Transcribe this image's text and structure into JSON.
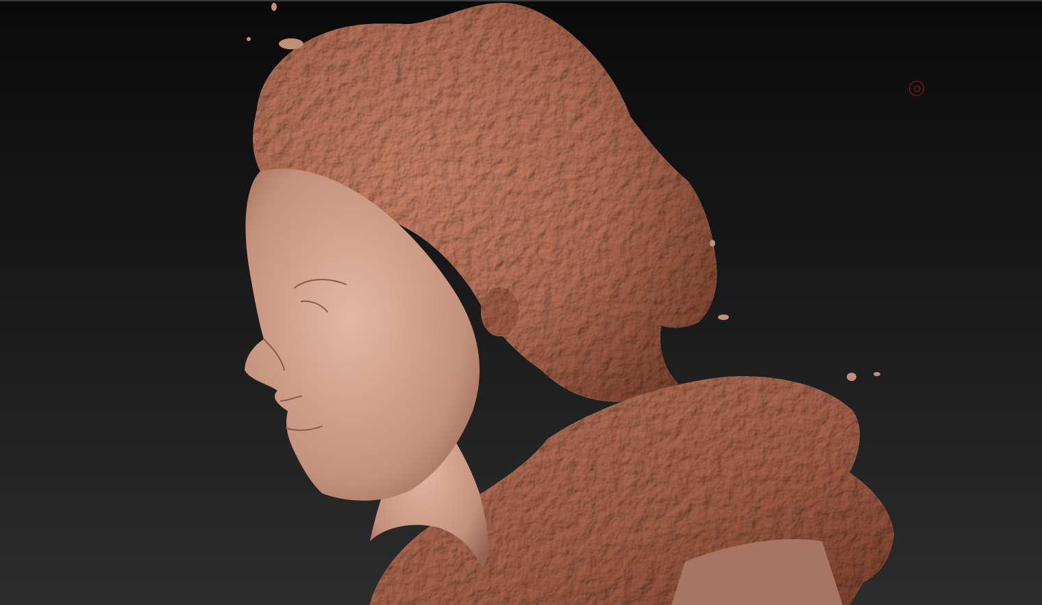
{
  "viewport": {
    "background_top": "#0a0a0a",
    "background_bottom": "#2c2c2c"
  },
  "model": {
    "material_color": "#c99782",
    "material_shadow": "#8a5a48",
    "material_highlight": "#e6b9a4"
  },
  "icons": {
    "cursor": "brush-cursor-icon"
  }
}
